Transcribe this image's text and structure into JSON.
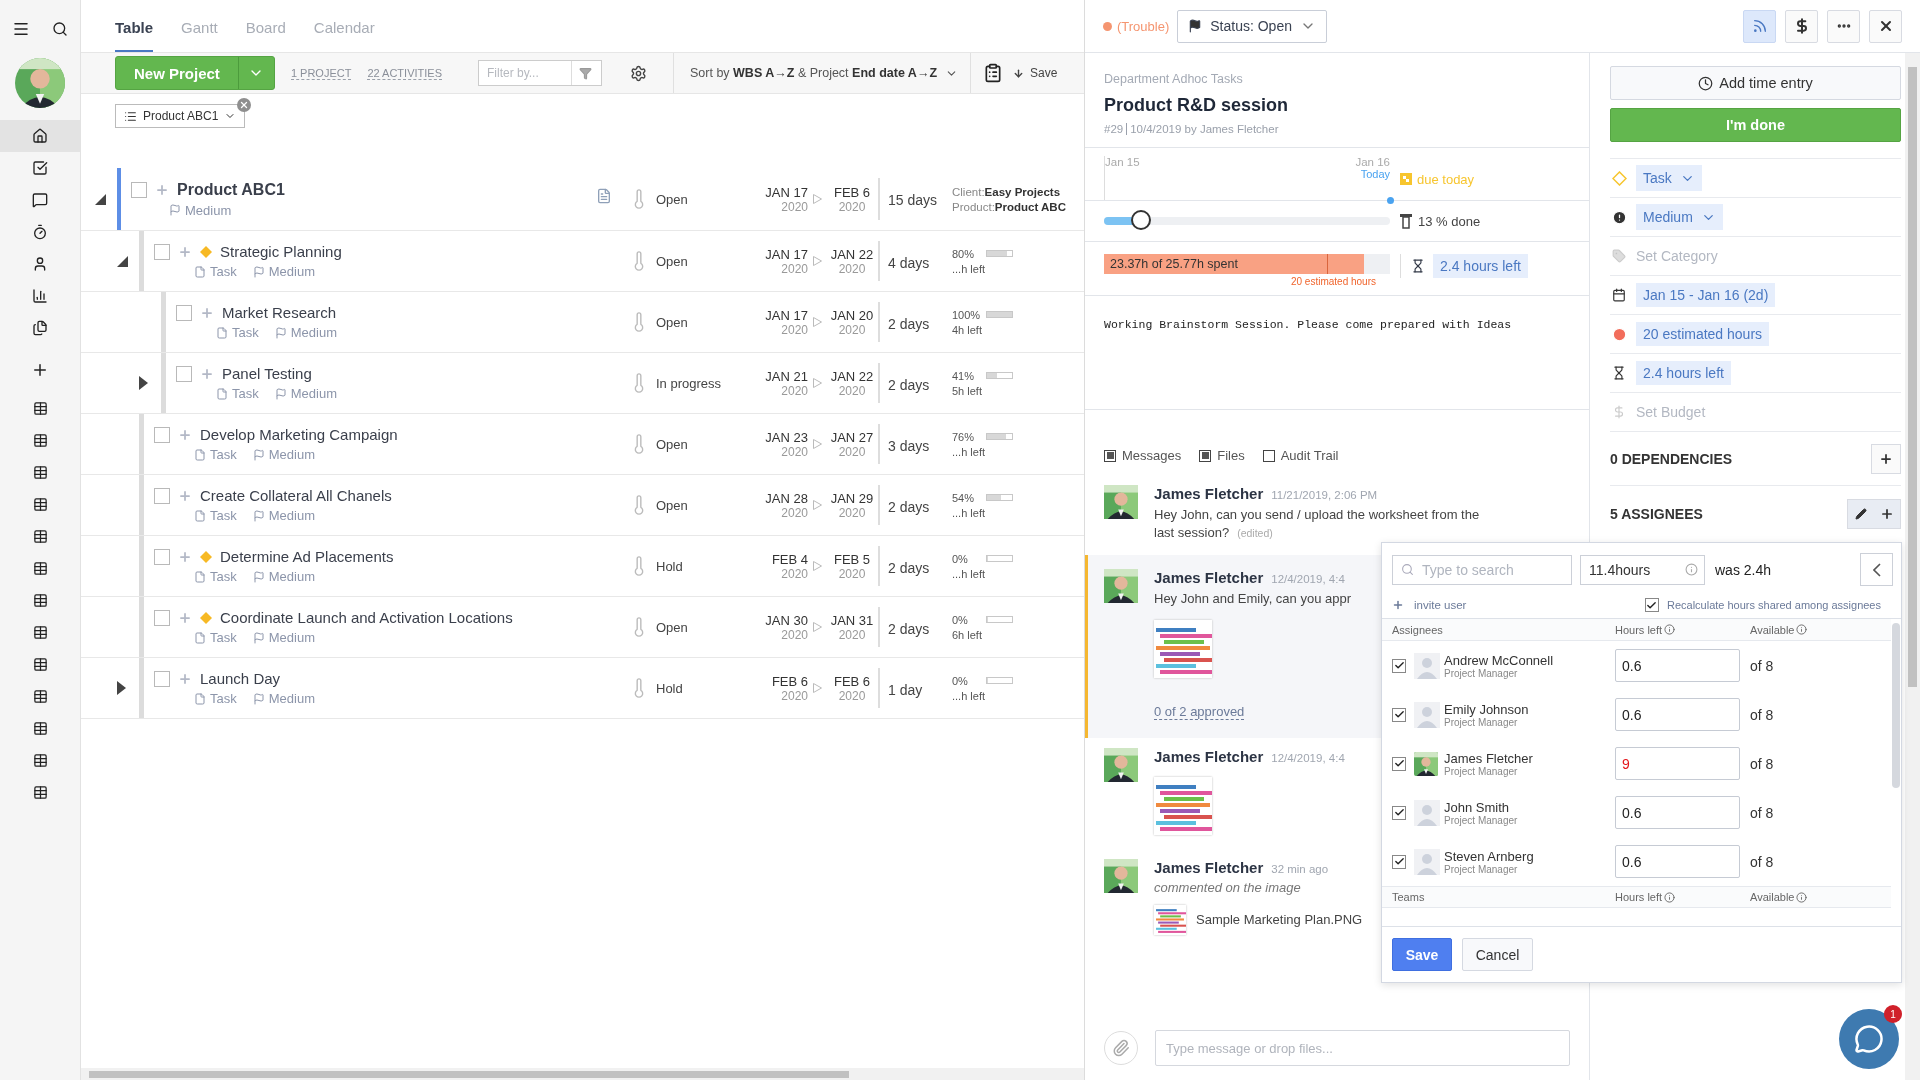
{
  "sidebar": {
    "nav_items": [
      {
        "selected": true
      },
      {
        "selected": false
      },
      {
        "selected": false
      },
      {
        "selected": false
      },
      {
        "selected": false
      },
      {
        "selected": false
      },
      {
        "selected": false
      }
    ],
    "lists": [
      {
        "selected": false
      },
      {
        "selected": false
      },
      {
        "selected": false
      },
      {
        "selected": false
      },
      {
        "selected": false
      },
      {
        "selected": false
      },
      {
        "selected": false
      },
      {
        "selected": false
      },
      {
        "selected": false
      },
      {
        "selected": false
      },
      {
        "selected": false
      },
      {
        "selected": false
      },
      {
        "selected": false
      }
    ]
  },
  "tabs": [
    {
      "label": "Table",
      "selected": true
    },
    {
      "label": "Gantt",
      "selected": false
    },
    {
      "label": "Board",
      "selected": false
    },
    {
      "label": "Calendar",
      "selected": false
    }
  ],
  "toolbar": {
    "new_button": "New Project",
    "counts": [
      "1 PROJECT",
      "22 ACTIVITIES"
    ],
    "filter_placeholder": "Filter by...",
    "sort": "Sort by **WBS A→Z** & Project **End date A→Z**",
    "save": "Save"
  },
  "chips": [
    "Product ABC1"
  ],
  "rows": [
    {
      "kind": "project",
      "title": "Product ABC1",
      "checked": false,
      "expandable": true,
      "expanded": true,
      "priority": "Medium",
      "status": "Open",
      "start_day": "JAN 17",
      "start_year": "2020",
      "end_day": "FEB 6",
      "end_year": "2020",
      "duration": "15 days",
      "info": [
        {
          "label": "Client:",
          "value": "Easy Projects"
        },
        {
          "label": "Product:",
          "value": "Product ABC"
        }
      ],
      "children": [
        {
          "kind": "task",
          "title": "Strategic Planning",
          "checked": false,
          "expandable": true,
          "expanded": true,
          "milestone": true,
          "type": "Task",
          "priority": "Medium",
          "status": "Open",
          "start_day": "JAN 17",
          "start_year": "2020",
          "end_day": "JAN 22",
          "end_year": "2020",
          "duration": "4 days",
          "progress": "80%",
          "level": 0.8,
          "left": "...h left",
          "children": [
            {
              "kind": "task",
              "title": "Market Research",
              "checked": false,
              "expandable": false,
              "milestone": false,
              "type": "Task",
              "priority": "Medium",
              "status": "Open",
              "start_day": "JAN 17",
              "start_year": "2020",
              "end_day": "JAN 20",
              "end_year": "2020",
              "duration": "2 days",
              "progress": "100%",
              "level": 1,
              "left": "4h left"
            },
            {
              "kind": "task",
              "title": "Panel Testing",
              "checked": false,
              "expandable": true,
              "expanded": false,
              "milestone": false,
              "type": "Task",
              "priority": "Medium",
              "status": "In progress",
              "start_day": "JAN 21",
              "start_year": "2020",
              "end_day": "JAN 22",
              "end_year": "2020",
              "duration": "2 days",
              "progress": "41%",
              "level": 0.41,
              "left": "5h left"
            }
          ]
        },
        {
          "kind": "task",
          "title": "Develop Marketing Campaign",
          "checked": false,
          "expandable": false,
          "milestone": false,
          "type": "Task",
          "priority": "Medium",
          "status": "Open",
          "start_day": "JAN 23",
          "start_year": "2020",
          "end_day": "JAN 27",
          "end_year": "2020",
          "duration": "3 days",
          "progress": "76%",
          "level": 0.76,
          "left": "...h left"
        },
        {
          "kind": "task",
          "title": "Create Collateral All Chanels",
          "checked": false,
          "expandable": false,
          "milestone": false,
          "type": "Task",
          "priority": "Medium",
          "status": "Open",
          "start_day": "JAN 28",
          "start_year": "2020",
          "end_day": "JAN 29",
          "end_year": "2020",
          "duration": "2 days",
          "progress": "54%",
          "level": 0.54,
          "left": "...h left"
        },
        {
          "kind": "task",
          "title": "Determine Ad Placements",
          "checked": false,
          "expandable": false,
          "milestone": true,
          "type": "Task",
          "priority": "Medium",
          "status": "Hold",
          "start_day": "FEB 4",
          "start_year": "2020",
          "end_day": "FEB 5",
          "end_year": "2020",
          "duration": "2 days",
          "progress": "0%",
          "level": 0,
          "left": "...h left"
        },
        {
          "kind": "task",
          "title": "Coordinate Launch and Activation Locations",
          "checked": false,
          "expandable": false,
          "milestone": true,
          "type": "Task",
          "priority": "Medium",
          "status": "Open",
          "start_day": "JAN 30",
          "start_year": "2020",
          "end_day": "JAN 31",
          "end_year": "2020",
          "duration": "2 days",
          "progress": "0%",
          "level": 0,
          "left": "6h left"
        },
        {
          "kind": "task",
          "title": "Launch Day",
          "checked": false,
          "expandable": true,
          "expanded": false,
          "milestone": false,
          "type": "Task",
          "priority": "Medium",
          "status": "Hold",
          "start_day": "FEB 6",
          "start_year": "2020",
          "end_day": "FEB 6",
          "end_year": "2020",
          "duration": "1 day",
          "progress": "0%",
          "level": 0,
          "left": "...h left"
        }
      ]
    }
  ],
  "task_panel": {
    "trouble": "(Trouble)",
    "status": "Status: Open",
    "feed_on": true,
    "breadcrumb": "Department Adhoc Tasks",
    "title": "Product R&D session",
    "number": "#29",
    "created": "10/4/2019 by James Fletcher",
    "timeline": {
      "start": "Jan 15",
      "end": "Jan 16",
      "today": "Today",
      "due": "due today"
    },
    "progress": {
      "level": 0.13,
      "label": "13 % done"
    },
    "spent": {
      "label": "23.37h of 25.77h spent",
      "level": 0.91,
      "estimate": {
        "level": 0.78,
        "label": "20 estimated hours"
      },
      "left": "2.4 hours left"
    },
    "description": "Working Brainstorm Session. Please come prepared with Ideas",
    "filters": [
      {
        "label": "Messages",
        "checked": true
      },
      {
        "label": "Files",
        "checked": true
      },
      {
        "label": "Audit Trail",
        "checked": false
      }
    ],
    "messages": [
      {
        "author": "James Fletcher",
        "time": "11/21/2019, 2:06 PM",
        "text": "Hey John, can you send / upload the worksheet from the last session?",
        "edited": "(edited)",
        "highlighted": false,
        "has_image": false
      },
      {
        "author": "James Fletcher",
        "time": "12/4/2019, 4:4",
        "text": "Hey John and Emily, can you appr",
        "highlighted": true,
        "has_image": true,
        "approval": "0 of 2 approved"
      },
      {
        "author": "James Fletcher",
        "time": "12/4/2019, 4:4",
        "highlighted": false,
        "has_image": true
      },
      {
        "author": "James Fletcher",
        "time": "32 min ago",
        "note": "commented on the image",
        "highlighted": false,
        "has_image": false,
        "file": "Sample Marketing Plan.PNG"
      }
    ],
    "composer_placeholder": "Type message or drop files..."
  },
  "side": {
    "add_time": "Add time entry",
    "done": "I'm done",
    "properties": [
      {
        "kind": "dropdown",
        "label": "Task"
      },
      {
        "kind": "dropdown",
        "label": "Medium"
      },
      {
        "kind": "empty",
        "label": "Set Category"
      },
      {
        "kind": "chip",
        "label": "Jan 15 - Jan 16 (2d)"
      },
      {
        "kind": "chip",
        "label": "20 estimated hours"
      },
      {
        "kind": "chip",
        "label": "2.4 hours left"
      },
      {
        "kind": "empty",
        "label": "Set Budget"
      }
    ],
    "dependencies": "0 DEPENDENCIES",
    "assignees": "5 ASSIGNEES"
  },
  "assign_popup": {
    "search_placeholder": "Type to search",
    "hours": "11.4hours",
    "was": "was 2.4h",
    "invite": "invite user",
    "recalc": {
      "label": "Recalculate hours shared among assignees",
      "checked": true
    },
    "columns": [
      "Assignees",
      "Hours left",
      "Available"
    ],
    "people": [
      {
        "name": "Andrew McConnell",
        "role": "Project Manager",
        "checked": true,
        "photo": false,
        "hours": "0.6",
        "over": false,
        "available": "of 8"
      },
      {
        "name": "Emily Johnson",
        "role": "Project Manager",
        "checked": true,
        "photo": false,
        "hours": "0.6",
        "over": false,
        "available": "of 8"
      },
      {
        "name": "James Fletcher",
        "role": "Project Manager",
        "checked": true,
        "photo": true,
        "hours": "9",
        "over": true,
        "available": "of 8"
      },
      {
        "name": "John Smith",
        "role": "Project Manager",
        "checked": true,
        "photo": false,
        "hours": "0.6",
        "over": false,
        "available": "of 8"
      },
      {
        "name": "Steven Arnberg",
        "role": "Project Manager",
        "checked": true,
        "photo": false,
        "hours": "0.6",
        "over": false,
        "available": "of 8"
      }
    ],
    "team_columns": [
      "Teams",
      "Hours left",
      "Available"
    ],
    "save": "Save",
    "cancel": "Cancel"
  },
  "chat_badge": "1"
}
